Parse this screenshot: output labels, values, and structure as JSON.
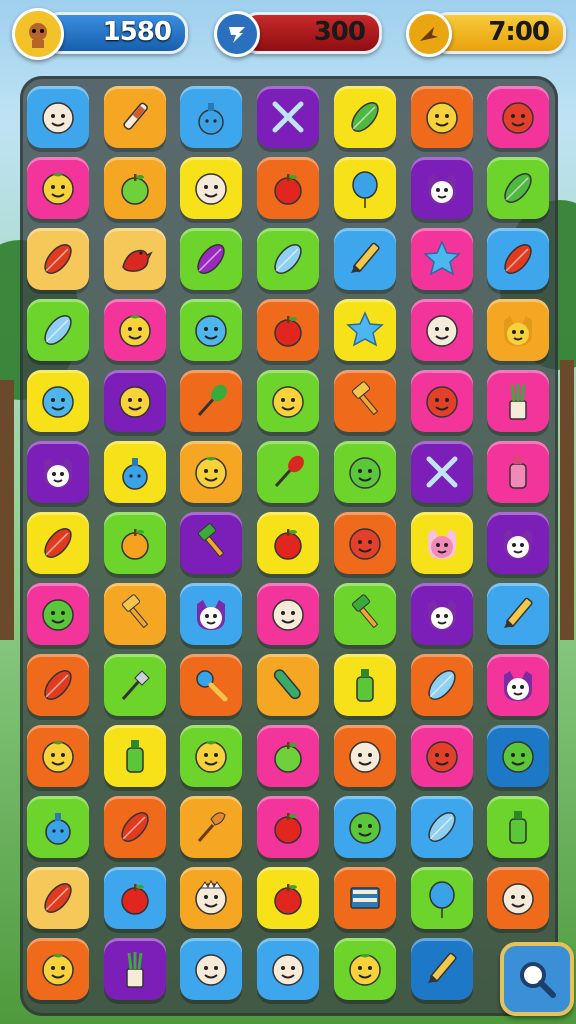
{
  "hud": {
    "coins": {
      "value": "1580",
      "icon": "mascot-icon",
      "color": "#1e6fc0"
    },
    "gems": {
      "value": "300",
      "icon": "gem-icon",
      "color": "#b3151b"
    },
    "timer": {
      "value": "7:00",
      "icon": "arrow-icon",
      "color": "#f2b211"
    }
  },
  "colors": {
    "B": "#3ea6ec",
    "O": "#f5a623",
    "P": "#7b1fb8",
    "Y": "#f7e21a",
    "R": "#f06a1c",
    "K": "#f2349b",
    "G": "#6cd42a",
    "T": "#f6c85a",
    "D": "#1e78c8"
  },
  "board": {
    "rows": [
      [
        [
          "B",
          "face-pale"
        ],
        [
          "O",
          "syringe"
        ],
        [
          "B",
          "potion-blue"
        ],
        [
          "P",
          "crossed-swords"
        ],
        [
          "Y",
          "leaf-green"
        ],
        [
          "R",
          "face-yellow"
        ],
        [
          "K",
          "face-red"
        ]
      ],
      [
        [
          "K",
          "fruit-yellow"
        ],
        [
          "O",
          "apple-green"
        ],
        [
          "Y",
          "face-pale"
        ],
        [
          "R",
          "apple-red"
        ],
        [
          "Y",
          "balloon-blue"
        ],
        [
          "P",
          "cat-white"
        ],
        [
          "G",
          "leaf-green"
        ]
      ],
      [
        [
          "T",
          "leaf-red"
        ],
        [
          "T",
          "bird-red"
        ],
        [
          "G",
          "leaf-purple"
        ],
        [
          "G",
          "leaf-blue"
        ],
        [
          "B",
          "pencil"
        ],
        [
          "K",
          "star-blue"
        ],
        [
          "B",
          "leaf-red"
        ]
      ],
      [
        [
          "G",
          "leaf-blue"
        ],
        [
          "K",
          "fruit-yellow"
        ],
        [
          "G",
          "face-blue"
        ],
        [
          "R",
          "apple-red"
        ],
        [
          "Y",
          "star-blue"
        ],
        [
          "K",
          "face-pale"
        ],
        [
          "O",
          "cat-yellow"
        ]
      ],
      [
        [
          "Y",
          "face-blue"
        ],
        [
          "P",
          "face-yellow"
        ],
        [
          "R",
          "wand-green"
        ],
        [
          "G",
          "face-yellow"
        ],
        [
          "R",
          "hammer"
        ],
        [
          "K",
          "face-red"
        ],
        [
          "K",
          "brush-cup"
        ]
      ],
      [
        [
          "P",
          "cat-white"
        ],
        [
          "Y",
          "potion-blue"
        ],
        [
          "O",
          "fruit-yellow"
        ],
        [
          "G",
          "wand-red"
        ],
        [
          "G",
          "face-green"
        ],
        [
          "P",
          "crossed-swords"
        ],
        [
          "K",
          "bottle-pink"
        ]
      ],
      [
        [
          "Y",
          "leaf-red"
        ],
        [
          "G",
          "apple-orange"
        ],
        [
          "P",
          "hammer-green"
        ],
        [
          "Y",
          "apple-red"
        ],
        [
          "R",
          "face-red"
        ],
        [
          "Y",
          "cat-pink"
        ],
        [
          "P",
          "cat-white"
        ]
      ],
      [
        [
          "K",
          "face-green"
        ],
        [
          "O",
          "hammer"
        ],
        [
          "B",
          "cat-white"
        ],
        [
          "K",
          "face-pale"
        ],
        [
          "G",
          "hammer-green"
        ],
        [
          "P",
          "cat-white"
        ],
        [
          "B",
          "pencil"
        ]
      ],
      [
        [
          "R",
          "leaf-red"
        ],
        [
          "G",
          "shovel"
        ],
        [
          "R",
          "key-blue"
        ],
        [
          "O",
          "tube-green"
        ],
        [
          "Y",
          "bottle-green"
        ],
        [
          "R",
          "leaf-blue"
        ],
        [
          "K",
          "cat-white"
        ]
      ],
      [
        [
          "R",
          "fruit-yellow"
        ],
        [
          "Y",
          "bottle-green"
        ],
        [
          "G",
          "fruit-yellow"
        ],
        [
          "K",
          "apple-green"
        ],
        [
          "R",
          "face-pale"
        ],
        [
          "K",
          "face-red"
        ],
        [
          "D",
          "face-green"
        ]
      ],
      [
        [
          "G",
          "potion-blue"
        ],
        [
          "R",
          "leaf-red"
        ],
        [
          "O",
          "brush"
        ],
        [
          "K",
          "apple-red"
        ],
        [
          "B",
          "face-green"
        ],
        [
          "B",
          "leaf-blue"
        ],
        [
          "G",
          "bottle-green"
        ]
      ],
      [
        [
          "T",
          "leaf-red"
        ],
        [
          "B",
          "apple-red"
        ],
        [
          "O",
          "face-crown"
        ],
        [
          "Y",
          "apple-red"
        ],
        [
          "R",
          "book-blue"
        ],
        [
          "G",
          "balloon-blue"
        ],
        [
          "R",
          "face-pale"
        ]
      ],
      [
        [
          "R",
          "fruit-yellow"
        ],
        [
          "P",
          "brush-cup"
        ],
        [
          "B",
          "face-pale"
        ],
        [
          "B",
          "face-pale"
        ],
        [
          "G",
          "fruit-yellow"
        ],
        [
          "D",
          "pencil"
        ]
      ]
    ]
  },
  "search_button": {
    "icon": "search-icon"
  }
}
